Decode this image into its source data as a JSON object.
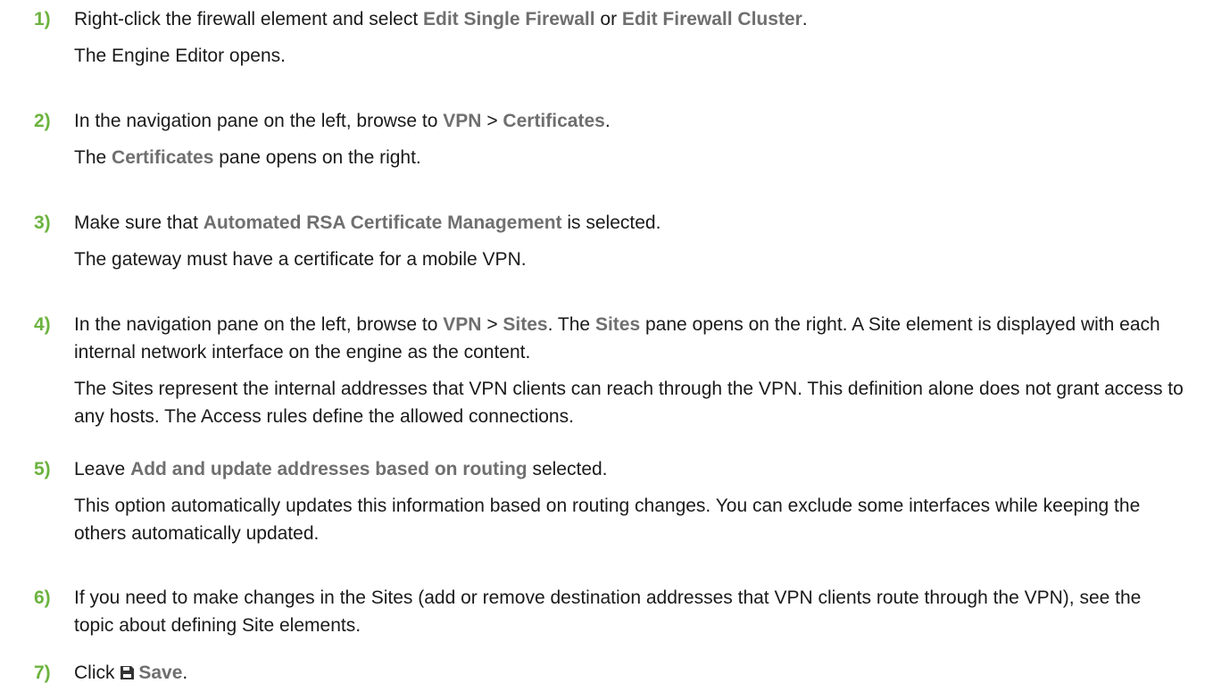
{
  "steps": [
    {
      "number": "1)",
      "a": "Right-click the firewall element and select ",
      "b": "Edit Single Firewall",
      "c": " or ",
      "d": "Edit Firewall Cluster",
      "e": ".",
      "result": "The Engine Editor opens."
    },
    {
      "number": "2)",
      "a": "In the navigation pane on the left, browse to ",
      "b": "VPN",
      "c": " > ",
      "d": "Certificates",
      "e": ".",
      "result_a": "The ",
      "result_b": "Certificates",
      "result_c": " pane opens on the right."
    },
    {
      "number": "3)",
      "a": "Make sure that ",
      "b": "Automated RSA Certificate Management",
      "c": " is selected.",
      "result": "The gateway must have a certificate for a mobile VPN."
    },
    {
      "number": "4)",
      "a": "In the navigation pane on the left, browse to ",
      "b": "VPN",
      "c": " > ",
      "d": "Sites",
      "e": ". The ",
      "f": "Sites",
      "g": " pane opens on the right. A Site element is displayed with each internal network interface on the engine as the content.",
      "result": "The Sites represent the internal addresses that VPN clients can reach through the VPN. This definition alone does not grant access to any hosts. The Access rules define the allowed connections."
    },
    {
      "number": "5)",
      "a": "Leave ",
      "b": "Add and update addresses based on routing",
      "c": " selected.",
      "result": "This option automatically updates this information based on routing changes. You can exclude some interfaces while keeping the others automatically updated."
    },
    {
      "number": "6)",
      "a": "If you need to make changes in the Sites (add or remove destination addresses that VPN clients route through the VPN), see the topic about defining Site elements."
    },
    {
      "number": "7)",
      "a": "Click ",
      "icon": "save-icon",
      "b": "Save",
      "c": "."
    }
  ]
}
